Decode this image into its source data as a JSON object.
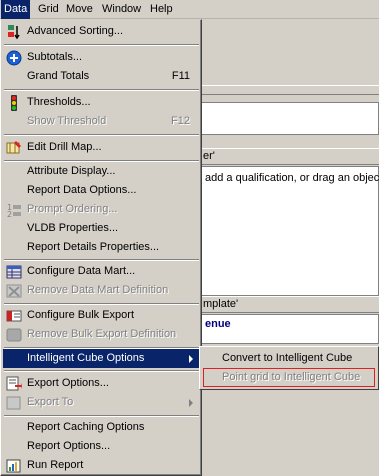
{
  "menubar": {
    "items": [
      {
        "label": "Data"
      },
      {
        "label": "Grid"
      },
      {
        "label": "Move"
      },
      {
        "label": "Window"
      },
      {
        "label": "Help"
      }
    ]
  },
  "background": {
    "header1": "er'",
    "hint": "add a qualification, or drag an object",
    "header2": "mplate'",
    "venue": "enue"
  },
  "menu": {
    "advanced_sorting": "Advanced Sorting...",
    "subtotals": "Subtotals...",
    "grand_totals": "Grand Totals",
    "grand_totals_shortcut": "F11",
    "thresholds": "Thresholds...",
    "show_threshold": "Show Threshold",
    "show_threshold_shortcut": "F12",
    "edit_drill_map": "Edit Drill Map...",
    "attribute_display": "Attribute Display...",
    "report_data_options": "Report Data Options...",
    "prompt_ordering": "Prompt Ordering...",
    "vldb_properties": "VLDB Properties...",
    "report_details_properties": "Report Details Properties...",
    "configure_data_mart": "Configure Data Mart...",
    "remove_data_mart_definition": "Remove Data Mart Definition",
    "configure_bulk_export": "Configure Bulk Export",
    "remove_bulk_export_definition": "Remove Bulk Export Definition",
    "intelligent_cube_options": "Intelligent Cube Options",
    "export_options": "Export Options...",
    "export_to": "Export To",
    "report_caching_options": "Report Caching Options",
    "report_options": "Report Options...",
    "run_report": "Run Report"
  },
  "submenu": {
    "convert_to_cube": "Convert to Intelligent Cube",
    "point_grid_to_cube": "Point grid to Intelligent Cube"
  },
  "colors": {
    "menu_bg": "#d4d0c8",
    "highlight": "#0a246a",
    "disabled": "#808080",
    "outline": "#e02020"
  }
}
